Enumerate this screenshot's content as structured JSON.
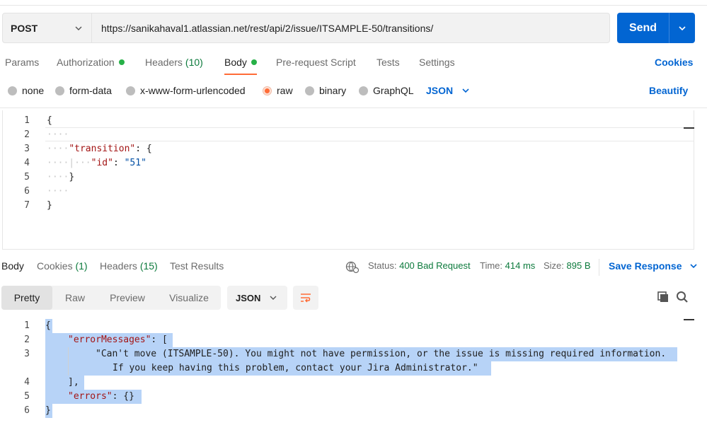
{
  "request": {
    "method": "POST",
    "url": "https://sanikahaval1.atlassian.net/rest/api/2/issue/ITSAMPLE-50/transitions/",
    "send_label": "Send"
  },
  "request_tabs": {
    "params": "Params",
    "authorization": "Authorization",
    "headers": "Headers",
    "headers_count": "(10)",
    "body": "Body",
    "prerequest": "Pre-request Script",
    "tests": "Tests",
    "settings": "Settings",
    "cookies": "Cookies"
  },
  "body_types": {
    "none": "none",
    "form_data": "form-data",
    "urlencoded": "x-www-form-urlencoded",
    "raw": "raw",
    "binary": "binary",
    "graphql": "GraphQL",
    "format": "JSON",
    "beautify": "Beautify"
  },
  "request_body": {
    "line_numbers": [
      "1",
      "2",
      "3",
      "4",
      "5",
      "6",
      "7"
    ],
    "lines": {
      "l1": "{",
      "l2_ws": "····",
      "l3_ws": "····",
      "l3_key": "\"transition\"",
      "l3_rest": ": {",
      "l4_ws": "····|···",
      "l4_key": "\"id\"",
      "l4_mid": ": ",
      "l4_val": "\"51\"",
      "l5_ws": "····",
      "l5_rest": "}",
      "l6_ws": "····",
      "l7": "}"
    }
  },
  "response_tabs": {
    "body": "Body",
    "cookies": "Cookies",
    "cookies_count": "(1)",
    "headers": "Headers",
    "headers_count": "(15)",
    "test_results": "Test Results"
  },
  "response_status": {
    "status_label": "Status:",
    "status_value": "400 Bad Request",
    "time_label": "Time:",
    "time_value": "414 ms",
    "size_label": "Size:",
    "size_value": "895 B",
    "save_response": "Save Response"
  },
  "response_view": {
    "pretty": "Pretty",
    "raw": "Raw",
    "preview": "Preview",
    "visualize": "Visualize",
    "format": "JSON"
  },
  "response_body": {
    "line_numbers": [
      "1",
      "2",
      "3",
      "4",
      "5",
      "6"
    ],
    "l1": "{",
    "l2_key": "\"errorMessages\"",
    "l2_rest": ": [",
    "l3a": "\"Can't move (ITSAMPLE-50). You might not have permission, or the issue is missing required information.",
    "l3b": "If you keep having this problem, contact your Jira Administrator.\"",
    "l4": "],",
    "l5_key": "\"errors\"",
    "l5_rest": ": {}",
    "l6": "}"
  },
  "colors": {
    "accent": "#ff6c37",
    "primary": "#0265d2",
    "success": "#0c7a3c",
    "selection": "#b7d3f7"
  }
}
